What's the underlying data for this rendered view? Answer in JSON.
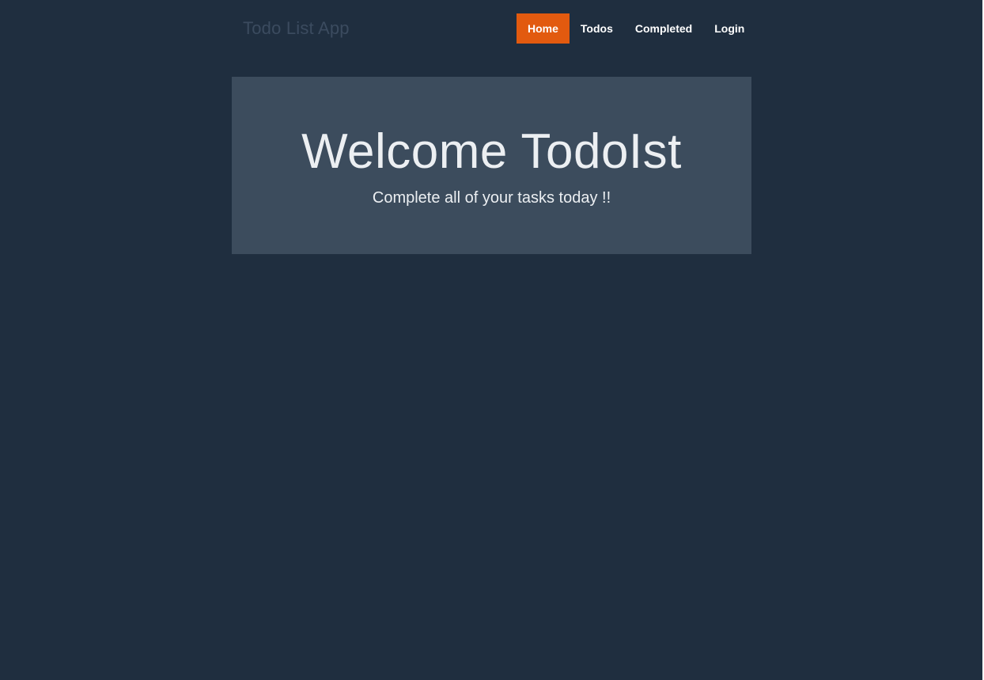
{
  "navbar": {
    "brand": "Todo List App",
    "items": [
      {
        "label": "Home",
        "active": true
      },
      {
        "label": "Todos",
        "active": false
      },
      {
        "label": "Completed",
        "active": false
      },
      {
        "label": "Login",
        "active": false
      }
    ]
  },
  "jumbotron": {
    "title": "Welcome TodoIst",
    "subtitle": "Complete all of your tasks today !!"
  },
  "colors": {
    "background": "#1f2e3f",
    "jumbotron": "#3c4c5d",
    "accent": "#e25a0f",
    "brand_text": "#3b4b5f",
    "text": "#eceff2"
  }
}
